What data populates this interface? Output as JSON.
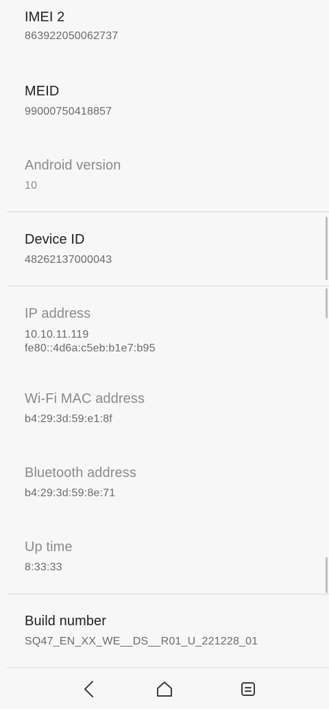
{
  "items": [
    {
      "title": "IMEI 2",
      "value": "863922050062737",
      "muted": false
    },
    {
      "title": "MEID",
      "value": "99000750418857",
      "muted": false
    },
    {
      "title": "Android version",
      "value": "10",
      "muted": true
    },
    {
      "title": "Device ID",
      "value": "48262137000043",
      "muted": false
    },
    {
      "title": "IP address",
      "value": "10.10.11.119",
      "value2": "fe80::4d6a:c5eb:b1e7:b95",
      "muted": true
    },
    {
      "title": "Wi-Fi MAC address",
      "value": "b4:29:3d:59:e1:8f",
      "muted": true
    },
    {
      "title": "Bluetooth address",
      "value": "b4:29:3d:59:8e:71",
      "muted": true
    },
    {
      "title": "Up time",
      "value": "8:33:33",
      "muted": true
    },
    {
      "title": "Build number",
      "value": "SQ47_EN_XX_WE__DS__R01_U_221228_01",
      "muted": false
    }
  ],
  "navbar": {
    "back_icon": "back-icon",
    "home_icon": "home-icon",
    "recents_icon": "recents-icon"
  }
}
